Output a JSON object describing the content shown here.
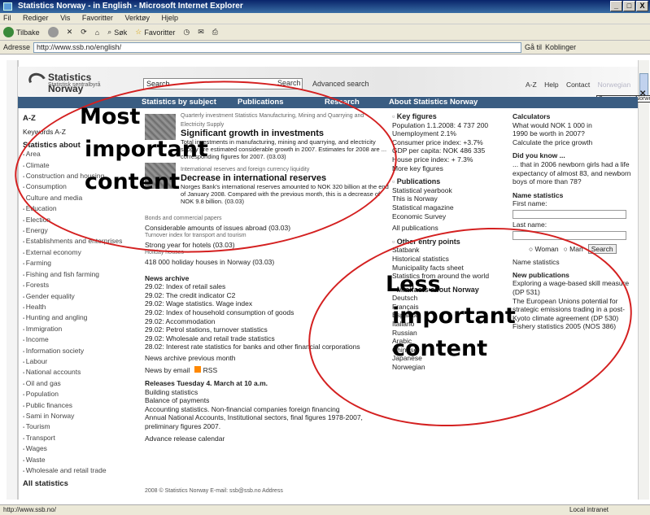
{
  "window": {
    "title": "Statistics Norway - in English - Microsoft Internet Explorer",
    "min": "_",
    "max": "□",
    "close": "X"
  },
  "menu": [
    "Fil",
    "Rediger",
    "Vis",
    "Favoritter",
    "Verktøy",
    "Hjelp"
  ],
  "toolbar": {
    "back": "Tilbake",
    "search": "Søk",
    "favorites": "Favoritter"
  },
  "address": {
    "label": "Adresse",
    "url": "http://www.ssb.no/english/",
    "go": "Gå til",
    "links": "Koblinger"
  },
  "site": {
    "logo_main": "Statistics Norway",
    "logo_sub": "Statistisk sentralbyrå",
    "search_placeholder": "Search",
    "search_button": "Search",
    "advanced_search": "Advanced search",
    "top_links": [
      "A-Z",
      "Help",
      "Contact",
      "Norwegian"
    ],
    "same_page": "Same page in Norwegian",
    "nav": [
      "Statistics by subject",
      "Publications",
      "Research",
      "About Statistics Norway"
    ]
  },
  "col1": {
    "az": "A-Z",
    "keywords": "Keywords A-Z",
    "heading": "Statistics about",
    "items": [
      "Area",
      "Climate",
      "Construction and housing",
      "Consumption",
      "Culture and media",
      "Education",
      "Election",
      "Energy",
      "Establishments and enterprises",
      "External economy",
      "Farming",
      "Fishing and fish farming",
      "Forests",
      "Gender equality",
      "Health",
      "Hunting and angling",
      "Immigration",
      "Income",
      "Information society",
      "Labour",
      "National accounts",
      "Oil and gas",
      "Population",
      "Public finances",
      "Sami in Norway",
      "Tourism",
      "Transport",
      "Wages",
      "Waste",
      "Wholesale and retail trade"
    ],
    "all": "All statistics"
  },
  "col2": {
    "n1_small": "Quarterly investment Statistics Manufacturing, Mining and Quarrying and Electricity Supply",
    "n1_head": "Significant growth in investments",
    "n1_body": "Total investments in manufacturing, mining and quarrying, and electricity supply are estimated considerable growth in 2007. Estimates for 2008 are ... corresponding figures for 2007. (03.03)",
    "n2_small": "International reserves and foreign currency liquidity",
    "n2_head": "Decrease in international reserves",
    "n2_body": "Norges Bank's international reserves amounted to NOK 320 billion at the end of January 2008. Compared with the previous month, this is a decrease of NOK 9.8 billion. (03.03)",
    "s1_small": "Bonds and commercial papers",
    "s1": "Considerable amounts of issues abroad (03.03)",
    "s2_small": "Turnover index for transport and tourism",
    "s2": "Strong year for hotels (03.03)",
    "s3_small": "Holiday houses",
    "s3": "418 000 holiday houses in Norway (03.03)",
    "archive_head": "News archive",
    "archive": [
      "29.02: Index of retail sales",
      "29.02: The credit indicator C2",
      "29.02: Wage statistics. Wage index",
      "29.02: Index of household consumption of goods",
      "29.02: Accommodation",
      "29.02: Petrol stations, turnover statistics",
      "29.02: Wholesale and retail trade statistics",
      "28.02: Interest rate statistics for banks and other financial corporations"
    ],
    "archive_prev": "News archive previous month",
    "email": "News by email",
    "rss": "RSS",
    "releases_head": "Releases Tuesday 4. March at 10 a.m.",
    "releases": [
      "Building statistics",
      "Balance of payments",
      "Accounting statistics. Non-financial companies foreign financing",
      "Annual National Accounts, Institutional sectors, final figures 1978-2007, preliminary figures 2007."
    ],
    "calendar": "Advance release calendar"
  },
  "col3": {
    "key_head": "Key figures",
    "key": [
      "Population 1.1.2008: 4 737 200",
      "Unemployment 2.1%",
      "Consumer price index: +3.7%",
      "GDP per capita: NOK 486 335",
      "House price index: + 7.3%"
    ],
    "more_key": "More key figures",
    "pub_head": "Publications",
    "pubs": [
      "Statistical yearbook",
      "This is Norway",
      "Statistical magazine",
      "Economic Survey"
    ],
    "all_pubs": "All publications",
    "other_head": "Other entry points",
    "other": [
      "Statbank",
      "Historical statistics",
      "Municipality facts sheet",
      "Statistics from around the world"
    ],
    "mini_head": "Minifacts about Norway",
    "langs": [
      "Deutsch",
      "Français",
      "Español",
      "Italiano",
      "Russian",
      "Arabic",
      "Chinese",
      "Japanese",
      "Norwegian"
    ]
  },
  "col4": {
    "calc_head": "Calculators",
    "calc_text": "What would NOK 1 000 in 1990 be worth in 2007?",
    "calc_link": "Calculate the price growth",
    "dyk_head": "Did you know ...",
    "dyk_text": "... that in 2006 newborn girls had a life expectancy of almost 83, and newborn boys of more than 78?",
    "names_head": "Name statistics",
    "first": "First name:",
    "last": "Last name:",
    "woman": "Woman",
    "man": "Man",
    "search": "Search",
    "names_link": "Name statistics",
    "newpub_head": "New publications",
    "newpubs": [
      "Exploring a wage-based skill measure (DP 531)",
      "The European Unions potential for strategic emissions trading in a post-Kyoto climate agreement (DP 530)",
      "Fishery statistics 2005 (NOS 386)"
    ]
  },
  "footer": "2008 © Statistics Norway   E-mail: ssb@ssb.no   Address",
  "status": {
    "url": "http://www.ssb.no/",
    "zone": "Local intranet"
  },
  "annotations": {
    "most1": "Most",
    "most2": "important",
    "most3": "content",
    "less1": "Less",
    "less2": "important",
    "less3": "content"
  }
}
